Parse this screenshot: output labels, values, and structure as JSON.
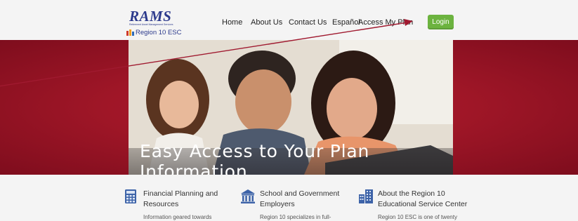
{
  "logo": {
    "wordmark": "RAMS",
    "tagline": "Retirement Asset Management Services",
    "sub": "Region 10 ESC"
  },
  "nav": {
    "items": [
      {
        "label": "Home"
      },
      {
        "label": "About Us"
      },
      {
        "label": "Contact Us"
      },
      {
        "label": "Español"
      },
      {
        "label": "Access My Plan"
      }
    ],
    "login_label": "Login"
  },
  "hero": {
    "caption": "Easy Access to Your Plan Information"
  },
  "features": [
    {
      "icon": "calculator-icon",
      "title": "Financial Planning and Resources",
      "text": "Information    geared    towards"
    },
    {
      "icon": "government-building-icon",
      "title": "School and Government Employers",
      "text": "Region  10  specializes  in  full-"
    },
    {
      "icon": "office-buildings-icon",
      "title": "About the Region 10 Educational Service Center",
      "text": "Region 10 ESC is one of twenty"
    }
  ],
  "colors": {
    "accent_green": "#6cb33f",
    "hero_red": "#9f1627",
    "logo_blue": "#2c3a8c"
  }
}
